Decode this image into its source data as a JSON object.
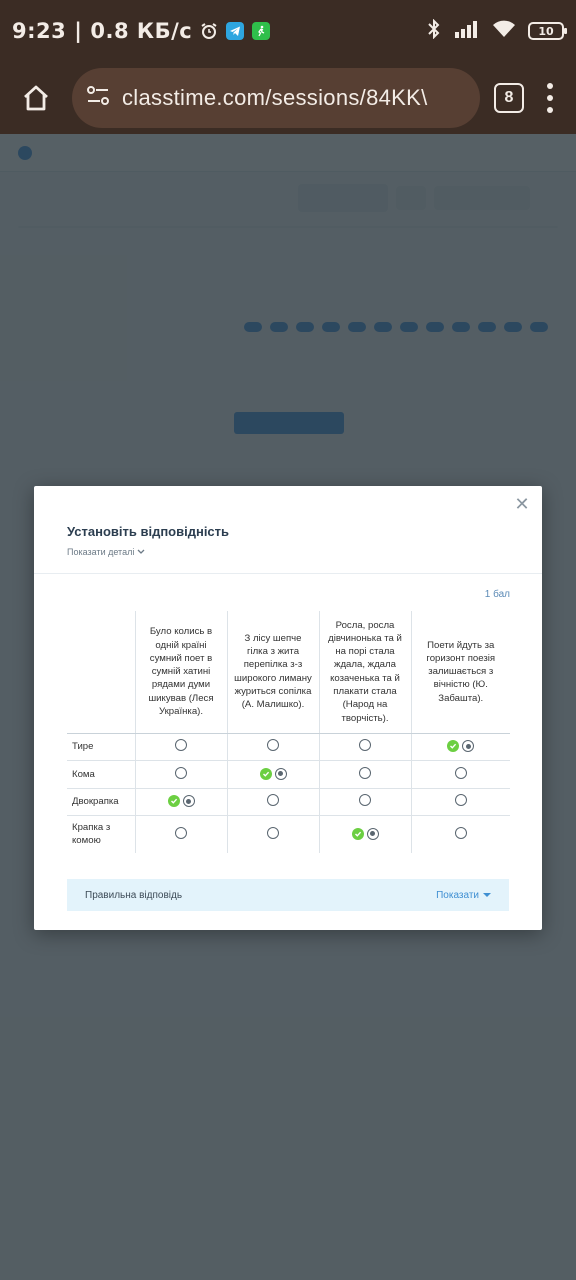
{
  "status_bar": {
    "time": "9:23",
    "separator": "|",
    "speed": "0.8 КБ/с",
    "battery": "10"
  },
  "browser": {
    "url": "classtime.com/sessions/84KK\\",
    "tab_count": "8"
  },
  "modal": {
    "title": "Установіть відповідність",
    "details_label": "Показати деталі",
    "points": "1 бал",
    "columns": [
      "Було колись в одній країні сумний поет в сумній хатині рядами думи шикував (Леся Українка).",
      "З лісу шепче гілка з жита перепілка з-з широкого лиману журиться сопілка  (А. Малишко).",
      "Росла, росла дівчинонька та й на порі стала ждала, ждала козаченька та й плакати стала (Народ на творчість).",
      "Поети йдуть за горизонт поезія залишається з вічністю (Ю. Забашта)."
    ],
    "rows": [
      {
        "label": "Тире",
        "selected_column": 4
      },
      {
        "label": "Кома",
        "selected_column": 2
      },
      {
        "label": "Двокрапка",
        "selected_column": 1
      },
      {
        "label": "Крапка з комою",
        "selected_column": 3
      }
    ],
    "correct_answer_label": "Правильна відповідь",
    "show_label": "Показати"
  },
  "colors": {
    "correct_check": "#6ccf42",
    "accent_blue": "#3f8fd2",
    "browser_chrome": "#3b2c24"
  }
}
